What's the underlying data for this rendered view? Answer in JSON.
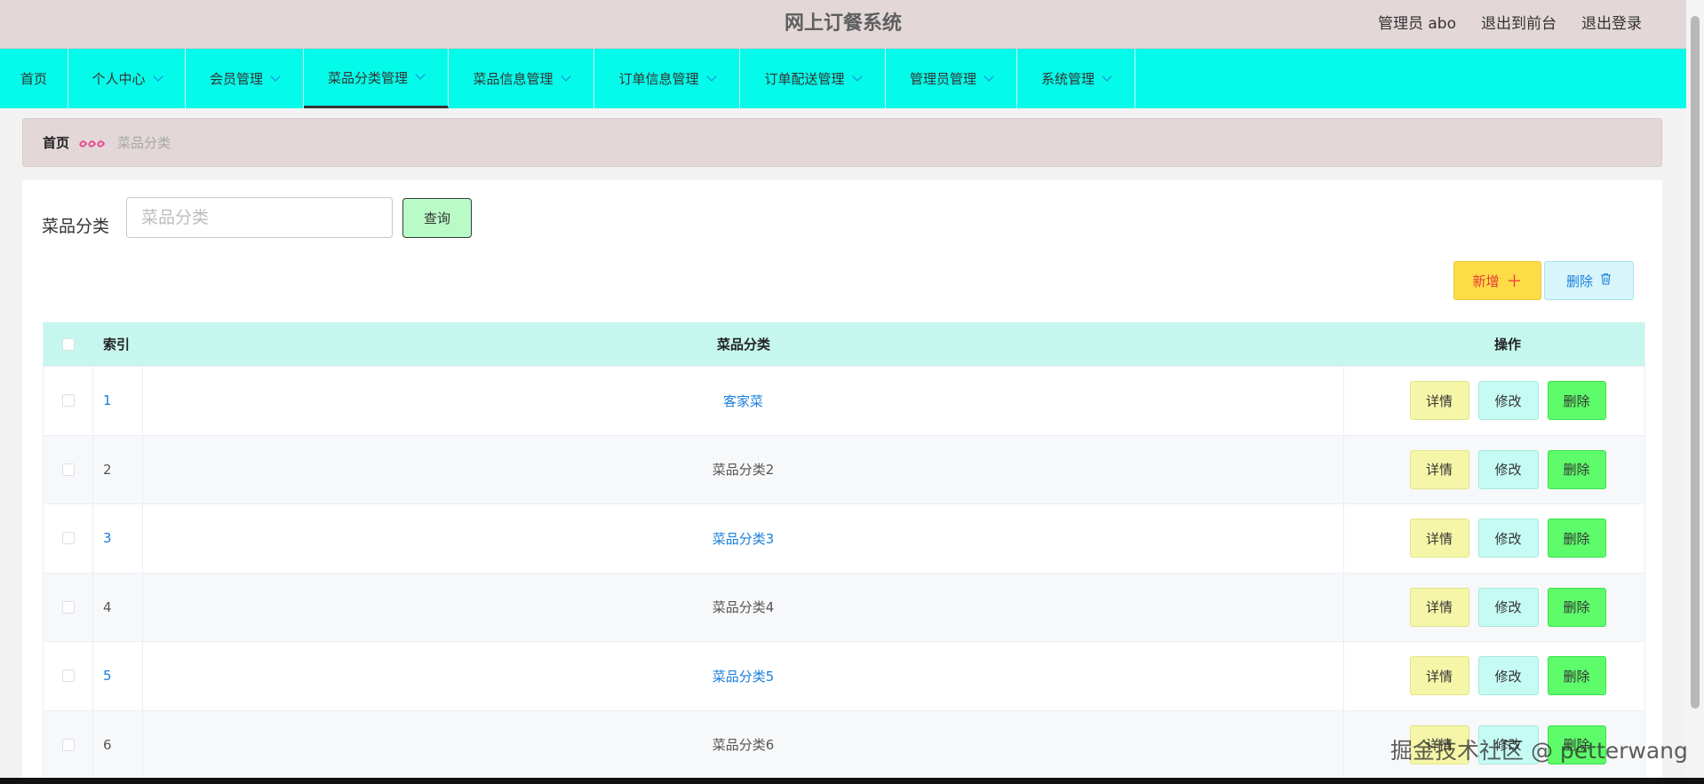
{
  "header": {
    "title": "网上订餐系统",
    "user": "管理员 abo",
    "to_front": "退出到前台",
    "logout": "退出登录"
  },
  "nav": {
    "items": [
      {
        "label": "首页"
      },
      {
        "label": "个人中心"
      },
      {
        "label": "会员管理"
      },
      {
        "label": "菜品分类管理"
      },
      {
        "label": "菜品信息管理"
      },
      {
        "label": "订单信息管理"
      },
      {
        "label": "订单配送管理"
      },
      {
        "label": "管理员管理"
      },
      {
        "label": "系统管理"
      }
    ],
    "active": "菜品分类管理"
  },
  "breadcrumb": {
    "home": "首页",
    "current": "菜品分类"
  },
  "search": {
    "label": "菜品分类",
    "placeholder": "菜品分类",
    "button": "查询"
  },
  "actions": {
    "add": "新增",
    "delete": "删除"
  },
  "table": {
    "headers": [
      "索引",
      "菜品分类",
      "操作"
    ],
    "op_labels": {
      "detail": "详情",
      "edit": "修改",
      "delete": "删除"
    },
    "rows": [
      {
        "index": "1",
        "name": "客家菜"
      },
      {
        "index": "2",
        "name": "菜品分类2"
      },
      {
        "index": "3",
        "name": "菜品分类3"
      },
      {
        "index": "4",
        "name": "菜品分类4"
      },
      {
        "index": "5",
        "name": "菜品分类5"
      },
      {
        "index": "6",
        "name": "菜品分类6"
      }
    ]
  },
  "watermark": "掘金技术社区 @ petterwang",
  "colors": {
    "header_bg": "#e3d7d8",
    "nav_bg": "#05fbe9",
    "table_head_bg": "#c6f7ee",
    "link": "#1a7fdb"
  }
}
